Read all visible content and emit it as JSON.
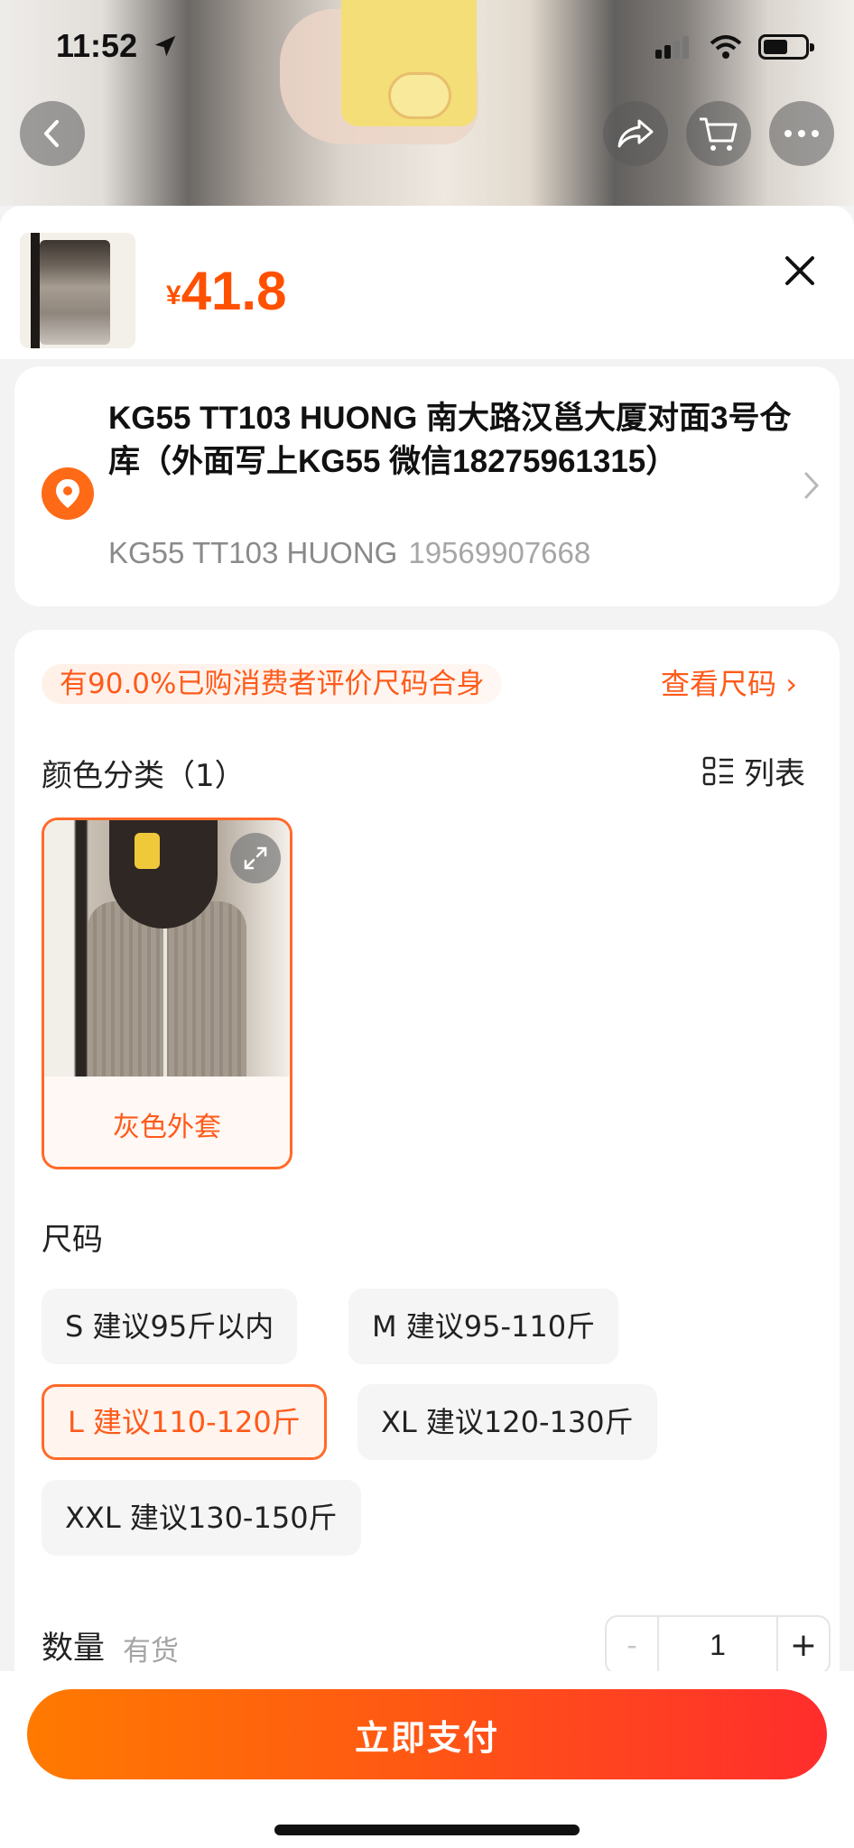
{
  "status_bar": {
    "time": "11:52"
  },
  "product": {
    "currency_symbol": "¥",
    "price": "41.8"
  },
  "address": {
    "main": "KG55  TT103 HUONG 南大路汉邕大厦对面3号仓库（外面写上KG55 微信18275961315）",
    "recipient": "KG55 TT103 HUONG",
    "phone": "19569907668"
  },
  "fit": {
    "text": "有90.0%已购消费者评价尺码合身",
    "size_chart_link": "查看尺码"
  },
  "color_section": {
    "title": "颜色分类（1）",
    "list_toggle": "列表",
    "options": [
      {
        "label": "灰色外套",
        "selected": true
      }
    ]
  },
  "size_section": {
    "title": "尺码",
    "options": [
      {
        "label": "S 建议95斤以内",
        "selected": false
      },
      {
        "label": "M 建议95-110斤",
        "selected": false
      },
      {
        "label": "L 建议110-120斤",
        "selected": true
      },
      {
        "label": "XL 建议120-130斤",
        "selected": false
      },
      {
        "label": "XXL 建议130-150斤",
        "selected": false
      }
    ]
  },
  "quantity": {
    "label": "数量",
    "stock": "有货",
    "minus": "-",
    "value": "1",
    "plus": "+"
  },
  "actions": {
    "pay": "立即支付"
  },
  "colors": {
    "accent": "#ff5000",
    "accent_light": "#fff4ee"
  }
}
